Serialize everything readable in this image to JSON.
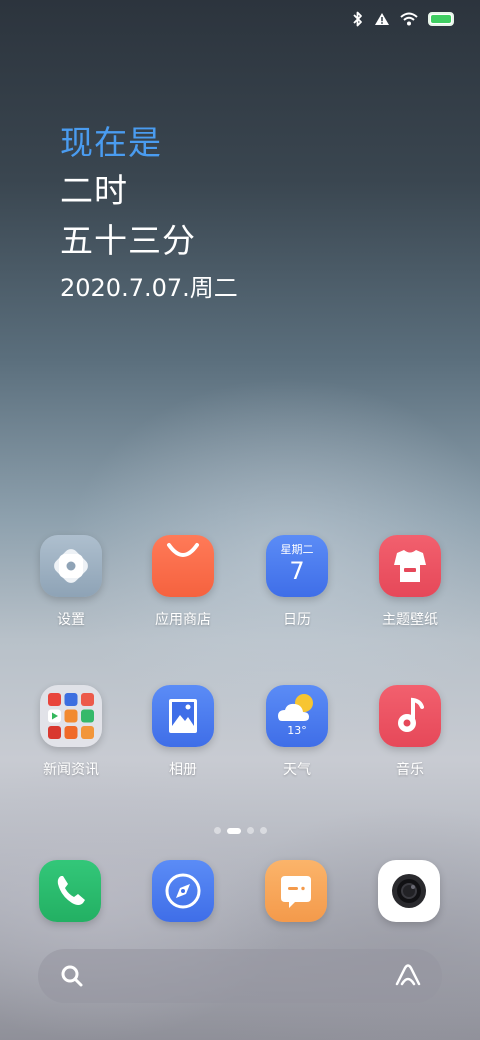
{
  "status_bar": {
    "icons": [
      "bluetooth-icon",
      "warning-icon",
      "wifi-icon",
      "battery-icon"
    ],
    "battery_color": "#3fce62"
  },
  "clock_widget": {
    "label": "现在是",
    "hour": "二时",
    "minute": "五十三分",
    "date": "2020.7.07.周二",
    "accent_color": "#4a9cf0"
  },
  "apps": [
    {
      "label": "设置",
      "icon": "settings-icon"
    },
    {
      "label": "应用商店",
      "icon": "app-store-icon"
    },
    {
      "label": "日历",
      "icon": "calendar-icon",
      "weekday": "星期二",
      "day": "7"
    },
    {
      "label": "主题壁纸",
      "icon": "theme-wallpaper-icon"
    },
    {
      "label": "新闻资讯",
      "icon": "news-folder-icon"
    },
    {
      "label": "相册",
      "icon": "gallery-icon"
    },
    {
      "label": "天气",
      "icon": "weather-icon",
      "temp": "13°"
    },
    {
      "label": "音乐",
      "icon": "music-icon"
    }
  ],
  "page_indicator": {
    "count": 4,
    "active": 1
  },
  "dock": [
    {
      "icon": "phone-icon",
      "color": "#2bbd6e"
    },
    {
      "icon": "browser-icon",
      "color": "#4a7ef0"
    },
    {
      "icon": "messages-icon",
      "color": "#f7a85a"
    },
    {
      "icon": "camera-icon",
      "color": "#ffffff"
    }
  ],
  "search_bar": {
    "icons": [
      "search-icon",
      "assistant-icon"
    ]
  }
}
